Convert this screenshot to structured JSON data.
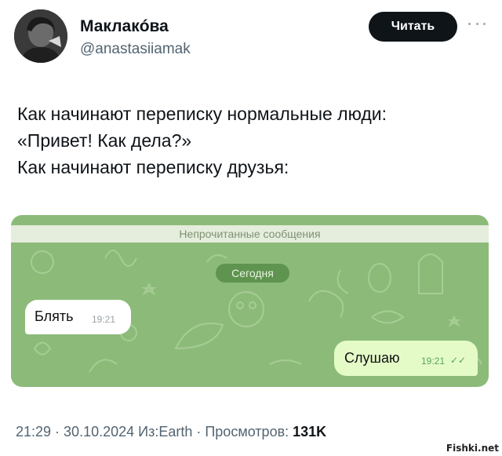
{
  "author": {
    "name": "Маклакóва",
    "handle": "@anastasiiamak",
    "follow_label": "Читать"
  },
  "tweet": {
    "lines": [
      "Как начинают переписку нормальные люди:",
      "«Привет! Как дела?»",
      "Как начинают переписку друзья:"
    ]
  },
  "chat": {
    "unread_label": "Непрочитанные сообщения",
    "date_label": "Сегодня",
    "incoming": {
      "text": "Блять",
      "time": "19:21"
    },
    "outgoing": {
      "text": "Слушаю",
      "time": "19:21"
    }
  },
  "meta": {
    "time": "21:29",
    "sep1": " · ",
    "date": "30.10.2024",
    "source": " Из:Earth",
    "sep2": " · ",
    "views_label": "Просмотров: ",
    "views_value": "131K"
  },
  "watermark": "Fishki.net",
  "colors": {
    "chat_background": "#8cbb79",
    "outgoing_bubble": "#e4fbc8",
    "follow_button": "#0f1419"
  }
}
